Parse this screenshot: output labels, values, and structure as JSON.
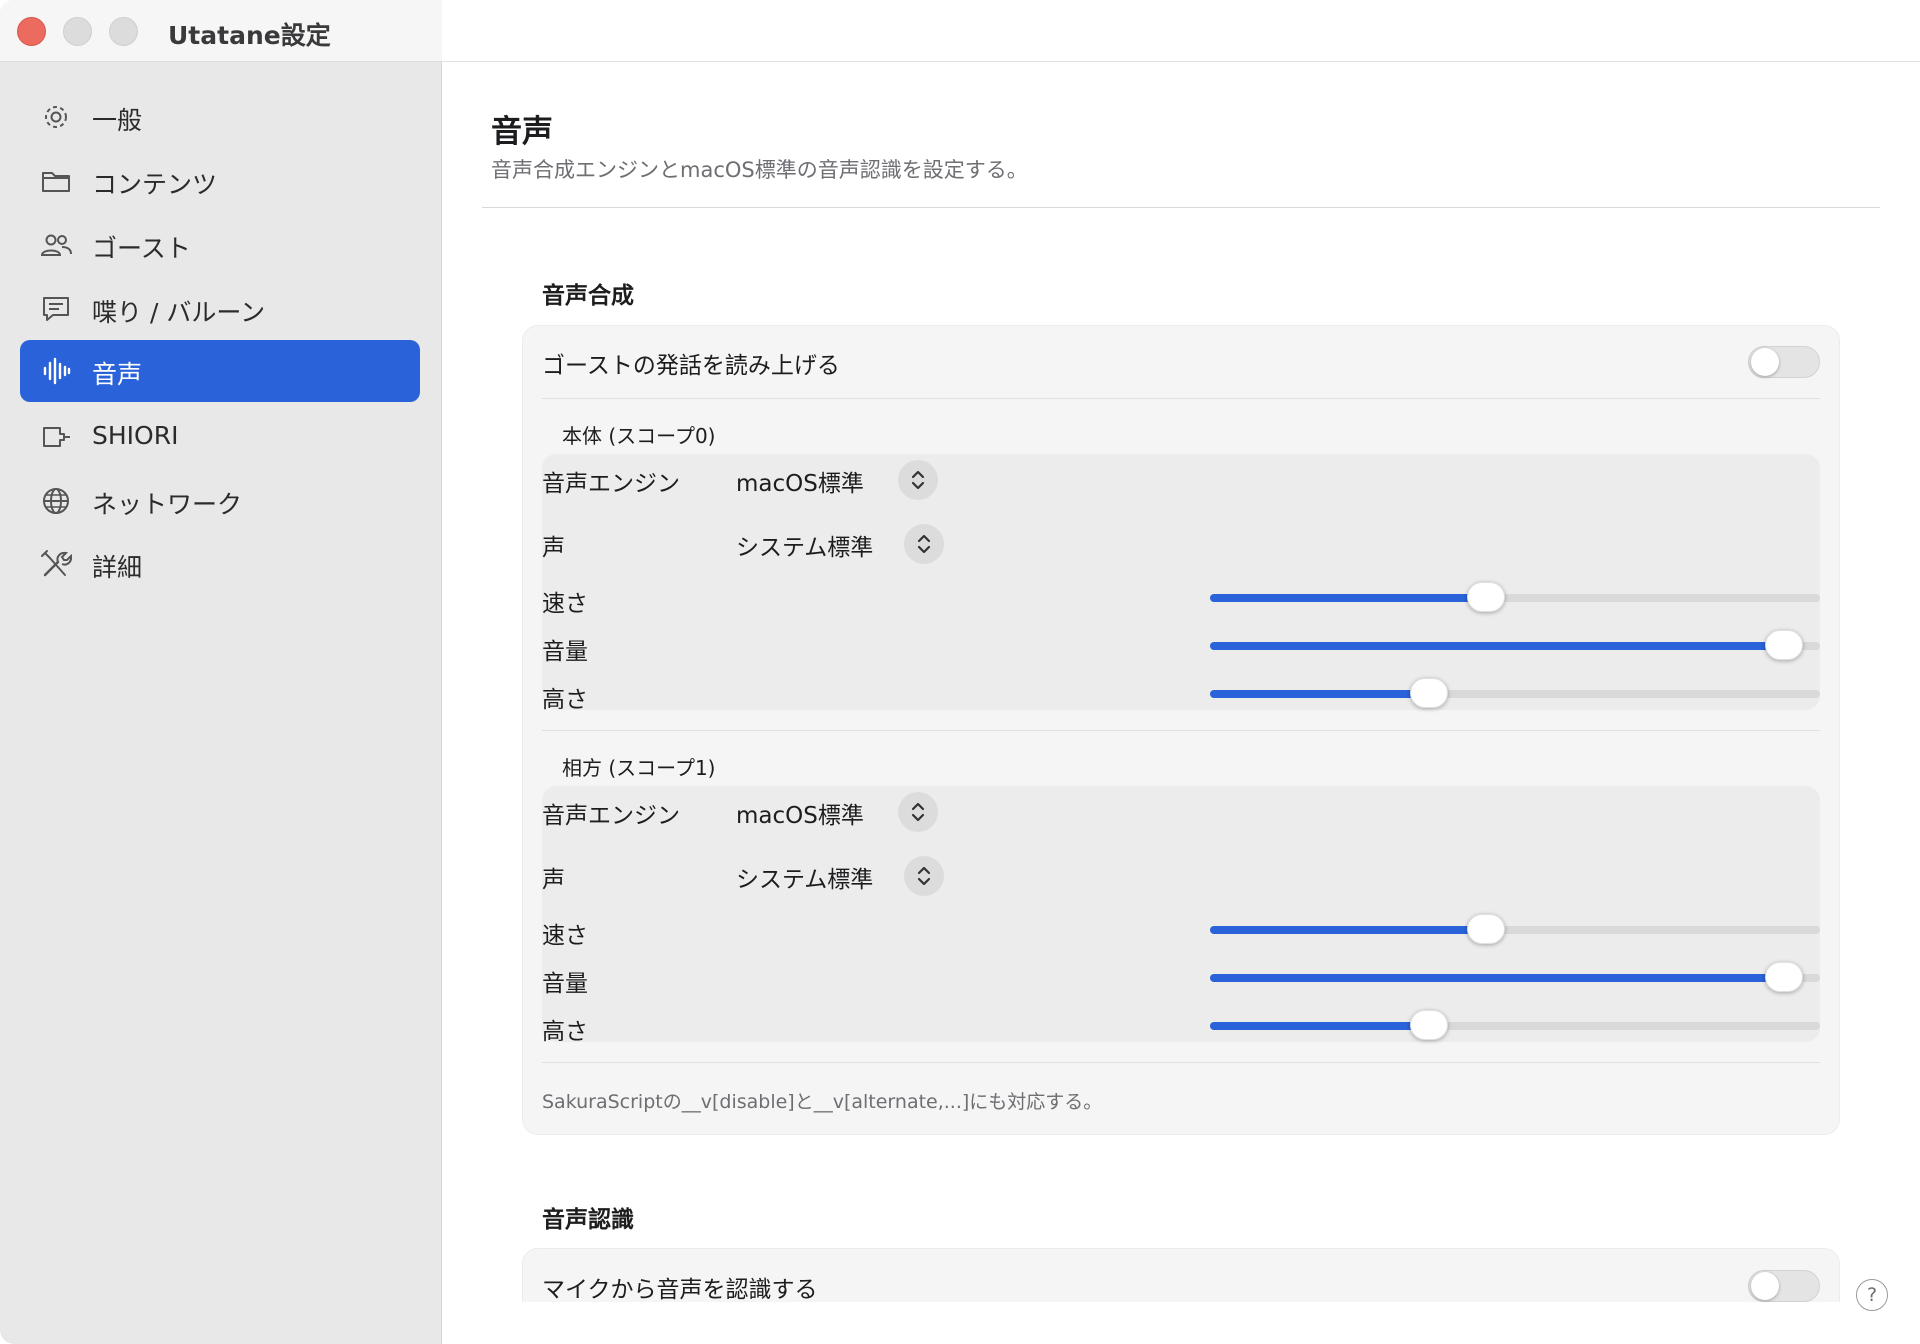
{
  "window": {
    "title": "Utatane設定"
  },
  "sidebar": {
    "items": [
      {
        "label": "一般",
        "icon": "gear-icon",
        "active": false
      },
      {
        "label": "コンテンツ",
        "icon": "folder-icon",
        "active": false
      },
      {
        "label": "ゴースト",
        "icon": "people-icon",
        "active": false
      },
      {
        "label": "喋り / バルーン",
        "icon": "speech-bubble-icon",
        "active": false
      },
      {
        "label": "音声",
        "icon": "waveform-icon",
        "active": true
      },
      {
        "label": "SHIORI",
        "icon": "plugin-icon",
        "active": false
      },
      {
        "label": "ネットワーク",
        "icon": "globe-icon",
        "active": false
      },
      {
        "label": "詳細",
        "icon": "tools-icon",
        "active": false
      }
    ]
  },
  "main": {
    "title": "音声",
    "subtitle": "音声合成エンジンとmacOS標準の音声認識を設定する。",
    "synthesis": {
      "section_title": "音声合成",
      "read_aloud_label": "ゴーストの発話を読み上げる",
      "read_aloud_on": false,
      "scopes": [
        {
          "label": "本体 (スコープ0)",
          "engine_label": "音声エンジン",
          "engine_value": "macOS標準",
          "voice_label": "声",
          "voice_value": "システム標準",
          "speed_label": "速さ",
          "speed": 0.45,
          "volume_label": "音量",
          "volume": 0.97,
          "pitch_label": "高さ",
          "pitch": 0.35
        },
        {
          "label": "相方 (スコープ1)",
          "engine_label": "音声エンジン",
          "engine_value": "macOS標準",
          "voice_label": "声",
          "voice_value": "システム標準",
          "speed_label": "速さ",
          "speed": 0.45,
          "volume_label": "音量",
          "volume": 0.97,
          "pitch_label": "高さ",
          "pitch": 0.35
        }
      ],
      "footnote": "SakuraScriptの__v[disable]と__v[alternate,...]にも対応する。"
    },
    "recognition": {
      "section_title": "音声認識",
      "mic_label": "マイクから音声を認識する",
      "mic_on": false
    }
  },
  "help": {
    "label": "?"
  },
  "colors": {
    "accent": "#2a62d9",
    "close": "#ed6a5e"
  }
}
